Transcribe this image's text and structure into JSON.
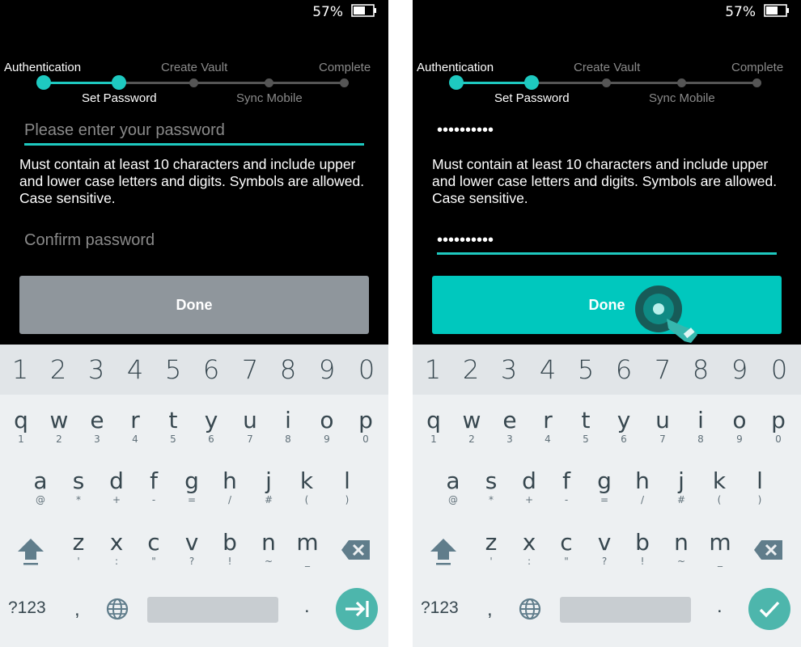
{
  "status": {
    "battery_percent": "57%"
  },
  "stepper": {
    "authentication": "Authentication",
    "set_password": "Set Password",
    "create_vault": "Create Vault",
    "sync_mobile": "Sync Mobile",
    "complete": "Complete"
  },
  "form": {
    "password_placeholder": "Please enter your password",
    "confirm_placeholder": "Confirm password",
    "help_text": "Must contain at least 10 characters and include upper and lower case letters and digits. Symbols are allowed. Case sensitive.",
    "done_label": "Done",
    "password_masked": "••••••••••",
    "confirm_masked": "••••••••••"
  },
  "keyboard": {
    "digits": [
      "1",
      "2",
      "3",
      "4",
      "5",
      "6",
      "7",
      "8",
      "9",
      "0"
    ],
    "row1": [
      [
        "q",
        "1"
      ],
      [
        "w",
        "2"
      ],
      [
        "e",
        "3"
      ],
      [
        "r",
        "4"
      ],
      [
        "t",
        "5"
      ],
      [
        "y",
        "6"
      ],
      [
        "u",
        "7"
      ],
      [
        "i",
        "8"
      ],
      [
        "o",
        "9"
      ],
      [
        "p",
        "0"
      ]
    ],
    "row2": [
      [
        "a",
        "@"
      ],
      [
        "s",
        "*"
      ],
      [
        "d",
        "+"
      ],
      [
        "f",
        "-"
      ],
      [
        "g",
        "="
      ],
      [
        "h",
        "/"
      ],
      [
        "j",
        "#"
      ],
      [
        "k",
        "("
      ],
      [
        "l",
        ")"
      ]
    ],
    "row3": [
      [
        "z",
        "'"
      ],
      [
        "x",
        ":"
      ],
      [
        "c",
        "\""
      ],
      [
        "v",
        "?"
      ],
      [
        "b",
        "!"
      ],
      [
        "n",
        "~"
      ],
      [
        "m",
        "_"
      ]
    ],
    "symbols_label": "?123",
    "comma": ",",
    "period": "."
  },
  "colors": {
    "accent": "#1ec9c0",
    "button_disabled": "#8f969c",
    "button_enabled": "#00c8be",
    "keyboard_action": "#4db6ac",
    "keyboard_bg": "#edf0f2"
  },
  "icons": {
    "battery": "battery-icon",
    "shift": "shift-arrow-icon",
    "backspace": "backspace-icon",
    "globe": "globe-icon",
    "next": "tab-next-icon",
    "done": "checkmark-icon",
    "touch": "touch-pointer-icon"
  }
}
